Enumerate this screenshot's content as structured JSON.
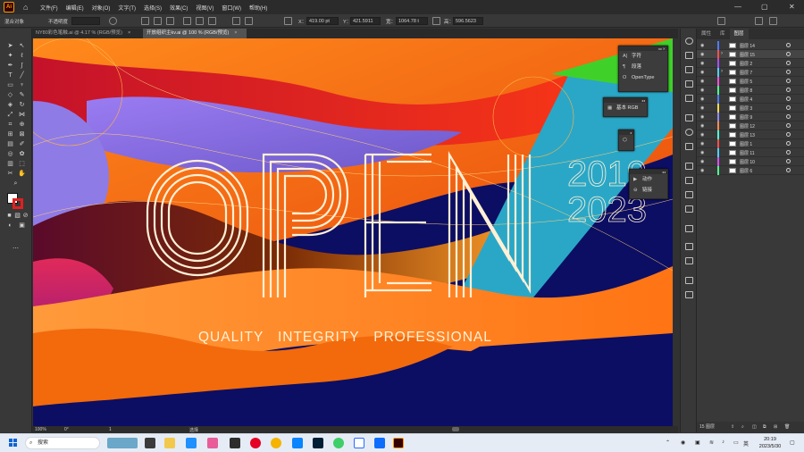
{
  "menubar": {
    "app_logo": "Ai",
    "items": [
      "文件(F)",
      "编辑(E)",
      "对象(O)",
      "文字(T)",
      "选择(S)",
      "效果(C)",
      "视图(V)",
      "窗口(W)",
      "帮助(H)"
    ],
    "window_controls": [
      "—",
      "▢",
      "✕"
    ]
  },
  "controlbar": {
    "left_label": "混合对象",
    "opacity_label": "不透明度",
    "x_label": "X：",
    "x_value": "419.00 pt",
    "y_label": "Y：",
    "y_value": "421.5911",
    "w_label": "宽：",
    "w_value": "1064.78 t",
    "h_label": "高：",
    "h_value": "596.5623"
  },
  "doc_tabs": [
    {
      "label": "NY80彩色笔触.ai @ 4.17 % (RGB/预览)",
      "close": "×"
    },
    {
      "label": "开放组织主kv.ai @ 100 % (RGB/预览)",
      "close": "×"
    }
  ],
  "artwork": {
    "headline": "OPEN",
    "year_top": "2019",
    "year_bottom": "2023",
    "tagline": "QUALITY   INTEGRITY   PROFESSIONAL",
    "colors": {
      "navy": "#0c0e63",
      "orange": "#f26a0c",
      "red": "#e6261e",
      "purple": "#7a6ad8",
      "teal": "#2aa7c7",
      "green": "#3fd12a",
      "cream": "#fff0d6"
    }
  },
  "float_panels": {
    "type_panel": [
      {
        "icon": "A|",
        "label": "字符"
      },
      {
        "icon": "¶",
        "label": "段落"
      },
      {
        "icon": "O",
        "label": "OpenType"
      }
    ],
    "color_panel": {
      "label": "基本 RGB"
    },
    "actions_panel": [
      {
        "icon": "▶",
        "label": "动作"
      },
      {
        "icon": "⊖",
        "label": "链接"
      }
    ]
  },
  "layers_panel": {
    "tabs": [
      "属性",
      "库",
      "图层"
    ],
    "active_tab": "图层",
    "rows": [
      {
        "name": "图层 14",
        "color": "#4f7cff",
        "expand": ""
      },
      {
        "name": "图层 15",
        "color": "#ff4f4f",
        "expand": "›"
      },
      {
        "name": "图层 2",
        "color": "#a64fff",
        "expand": ""
      },
      {
        "name": "图层 7",
        "color": "#4fd1ff",
        "expand": "›"
      },
      {
        "name": "图层 5",
        "color": "#ff4fd8",
        "expand": ""
      },
      {
        "name": "图层 8",
        "color": "#4fff8c",
        "expand": ""
      },
      {
        "name": "图层 4",
        "color": "#4f7cff",
        "expand": ""
      },
      {
        "name": "图层 3",
        "color": "#ffd84f",
        "expand": ""
      },
      {
        "name": "图层 9",
        "color": "#8c8cff",
        "expand": ""
      },
      {
        "name": "图层 12",
        "color": "#ff8c4f",
        "expand": ""
      },
      {
        "name": "图层 13",
        "color": "#4fffd8",
        "expand": ""
      },
      {
        "name": "图层 1",
        "color": "#ff4f4f",
        "expand": ""
      },
      {
        "name": "图层 11",
        "color": "#4fd1ff",
        "expand": ""
      },
      {
        "name": "图层 10",
        "color": "#d84fff",
        "expand": ""
      },
      {
        "name": "图层 6",
        "color": "#4fff8c",
        "expand": ""
      }
    ],
    "footer_count": "15 图层"
  },
  "statusbar": {
    "zoom": "100%",
    "rotation": "0°",
    "artboard": "1",
    "mode": "选择"
  },
  "taskbar": {
    "search_placeholder": "搜索",
    "ime": "英",
    "time": "20:19",
    "date": "2023/5/30"
  }
}
